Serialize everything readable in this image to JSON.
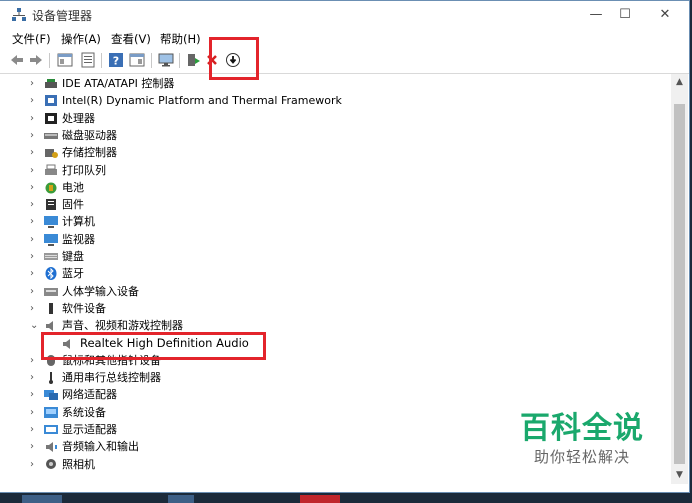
{
  "window": {
    "title": "设备管理器",
    "controls": {
      "minimize": "—",
      "maximize": "☐",
      "close": "✕"
    }
  },
  "menu": [
    "文件(F)",
    "操作(A)",
    "查看(V)",
    "帮助(H)"
  ],
  "tree": {
    "items": [
      {
        "label": "IDE ATA/ATAPI 控制器",
        "icon": "ide-controller-icon",
        "expanded": false
      },
      {
        "label": "Intel(R) Dynamic Platform and Thermal Framework",
        "icon": "thermal-framework-icon",
        "expanded": false
      },
      {
        "label": "处理器",
        "icon": "processor-icon",
        "expanded": false
      },
      {
        "label": "磁盘驱动器",
        "icon": "disk-drive-icon",
        "expanded": false
      },
      {
        "label": "存储控制器",
        "icon": "storage-controller-icon",
        "expanded": false
      },
      {
        "label": "打印队列",
        "icon": "printer-icon",
        "expanded": false
      },
      {
        "label": "电池",
        "icon": "battery-icon",
        "expanded": false
      },
      {
        "label": "固件",
        "icon": "firmware-icon",
        "expanded": false
      },
      {
        "label": "计算机",
        "icon": "computer-icon",
        "expanded": false
      },
      {
        "label": "监视器",
        "icon": "monitor-icon",
        "expanded": false
      },
      {
        "label": "键盘",
        "icon": "keyboard-icon",
        "expanded": false
      },
      {
        "label": "蓝牙",
        "icon": "bluetooth-icon",
        "expanded": false
      },
      {
        "label": "人体学输入设备",
        "icon": "hid-icon",
        "expanded": false
      },
      {
        "label": "软件设备",
        "icon": "software-device-icon",
        "expanded": false
      },
      {
        "label": "声音、视频和游戏控制器",
        "icon": "audio-icon",
        "expanded": true
      },
      {
        "label": "Realtek High Definition Audio",
        "icon": "speaker-icon",
        "child": true
      },
      {
        "label": "鼠标和其他指针设备",
        "icon": "mouse-icon",
        "expanded": false
      },
      {
        "label": "通用串行总线控制器",
        "icon": "usb-icon",
        "expanded": false
      },
      {
        "label": "网络适配器",
        "icon": "network-icon",
        "expanded": false
      },
      {
        "label": "系统设备",
        "icon": "system-device-icon",
        "expanded": false
      },
      {
        "label": "显示适配器",
        "icon": "display-adapter-icon",
        "expanded": false
      },
      {
        "label": "音频输入和输出",
        "icon": "audio-io-icon",
        "expanded": false
      },
      {
        "label": "照相机",
        "icon": "camera-icon",
        "expanded": false
      }
    ]
  },
  "watermark": {
    "title": "百科全说",
    "subtitle": "助你轻松解决"
  },
  "colors": {
    "highlight": "#e3242b",
    "watermark": "#1aa86c"
  }
}
